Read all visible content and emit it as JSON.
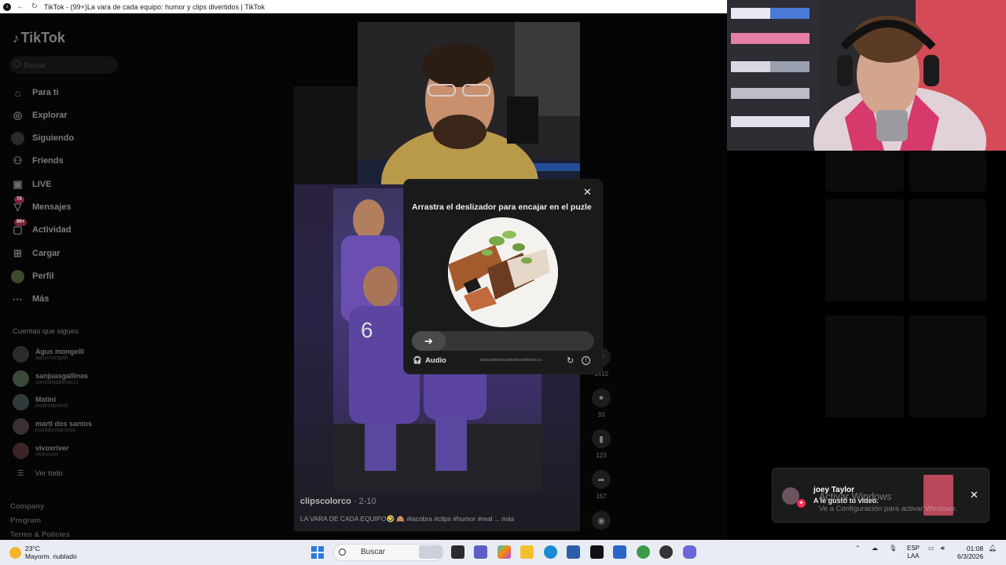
{
  "browser": {
    "tab_title": "TikTok - (99+)La vara de cada equipo: humor y clips divertidos | TikTok"
  },
  "sidebar": {
    "logo": "TikTok",
    "search_placeholder": "Buscar",
    "nav": [
      {
        "label": "Para ti",
        "icon": "home-icon"
      },
      {
        "label": "Explorar",
        "icon": "compass-icon"
      },
      {
        "label": "Siguiendo",
        "icon": "following-avatar-icon"
      },
      {
        "label": "Friends",
        "icon": "friends-icon"
      },
      {
        "label": "LIVE",
        "icon": "live-icon"
      },
      {
        "label": "Mensajes",
        "icon": "messages-icon",
        "badge": "70"
      },
      {
        "label": "Actividad",
        "icon": "activity-icon",
        "badge": "99+"
      },
      {
        "label": "Cargar",
        "icon": "upload-icon"
      },
      {
        "label": "Perfil",
        "icon": "profile-avatar-icon"
      },
      {
        "label": "Más",
        "icon": "more-icon"
      }
    ],
    "following_title": "Cuentas que sigues",
    "following": [
      {
        "name": "Agus mongelli",
        "handle": "agusmongelli"
      },
      {
        "name": "sanjuasgallinas",
        "handle": "sanjuasgallinas11"
      },
      {
        "name": "Matini",
        "handle": "mateotaminili"
      },
      {
        "name": "marti dos santos",
        "handle": "martidossantoss"
      },
      {
        "name": "vivoxriver",
        "handle": "vivoxriver"
      }
    ],
    "see_all": "Ver todo",
    "footer": [
      "Company",
      "Program",
      "Terms & Policies"
    ]
  },
  "video": {
    "author": "clipscolorco",
    "date": "· 2-10",
    "caption": "LA VARA DE CADA EQUIPO🤣 🙈 #lacobra #clips #humor #real ... más"
  },
  "actions": [
    {
      "icon": "heart-icon",
      "count": "1410"
    },
    {
      "icon": "comment-icon",
      "count": "33"
    },
    {
      "icon": "bookmark-icon",
      "count": "123"
    },
    {
      "icon": "share-icon",
      "count": "167"
    }
  ],
  "captcha": {
    "title": "Arrastra el deslizador para encajar en el puzle",
    "audio_label": "Audio",
    "code": "20260306f2060429830f9460f8f0D0CA3"
  },
  "notification": {
    "name": "joey Taylor",
    "message": "A le gustó tu video."
  },
  "windows_watermark": {
    "line1": "Activar Windows",
    "line2": "Ve a Configuración para activar Windows."
  },
  "taskbar": {
    "weather_temp": "23°C",
    "weather_desc": "Mayorm. nublado",
    "search_label": "Buscar",
    "lang_top": "ESP",
    "lang_bottom": "LAA",
    "time": "01:08",
    "date": "6/3/2026"
  },
  "colors": {
    "tiktok_red": "#fe2c55",
    "windows_blue": "#2b7bd9"
  }
}
